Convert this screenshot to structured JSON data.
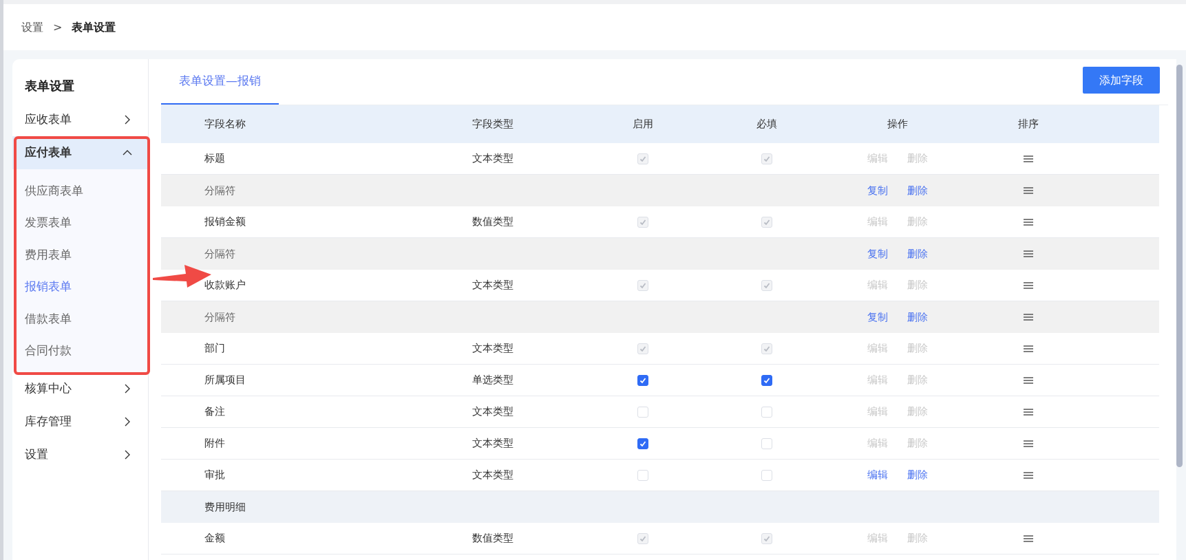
{
  "breadcrumb": [
    {
      "label": "设置",
      "current": false
    },
    {
      "label": "表单设置",
      "current": true
    }
  ],
  "breadcrumb_separator": ">",
  "sidebar": {
    "title": "表单设置",
    "items": [
      {
        "label": "应收表单",
        "expanded": false
      },
      {
        "label": "应付表单",
        "expanded": true,
        "children": [
          {
            "label": "供应商表单",
            "selected": false
          },
          {
            "label": "发票表单",
            "selected": false
          },
          {
            "label": "费用表单",
            "selected": false
          },
          {
            "label": "报销表单",
            "selected": true
          },
          {
            "label": "借款表单",
            "selected": false
          },
          {
            "label": "合同付款",
            "selected": false
          }
        ]
      },
      {
        "label": "核算中心",
        "expanded": false
      },
      {
        "label": "库存管理",
        "expanded": false
      },
      {
        "label": "设置",
        "expanded": false
      }
    ]
  },
  "tabs": [
    {
      "label": "表单设置—报销",
      "selected": true
    }
  ],
  "add_button": "添加字段",
  "table": {
    "columns": [
      "字段名称",
      "字段类型",
      "启用",
      "必填",
      "操作",
      "排序"
    ],
    "rows": [
      {
        "kind": "field",
        "name": "标题",
        "type": "文本类型",
        "enabled": {
          "checked": true,
          "disabled": true
        },
        "required": {
          "checked": true,
          "disabled": true
        },
        "actions": [
          {
            "label": "编辑",
            "disabled": true
          },
          {
            "label": "删除",
            "disabled": true
          }
        ]
      },
      {
        "kind": "separator",
        "name": "分隔符",
        "actions": [
          {
            "label": "复制",
            "disabled": false
          },
          {
            "label": "删除",
            "disabled": false
          }
        ]
      },
      {
        "kind": "field",
        "name": "报销金额",
        "type": "数值类型",
        "enabled": {
          "checked": true,
          "disabled": true
        },
        "required": {
          "checked": true,
          "disabled": true
        },
        "actions": [
          {
            "label": "编辑",
            "disabled": true
          },
          {
            "label": "删除",
            "disabled": true
          }
        ]
      },
      {
        "kind": "separator",
        "name": "分隔符",
        "actions": [
          {
            "label": "复制",
            "disabled": false
          },
          {
            "label": "删除",
            "disabled": false
          }
        ]
      },
      {
        "kind": "field",
        "name": "收款账户",
        "type": "文本类型",
        "enabled": {
          "checked": true,
          "disabled": true
        },
        "required": {
          "checked": true,
          "disabled": true
        },
        "actions": [
          {
            "label": "编辑",
            "disabled": true
          },
          {
            "label": "删除",
            "disabled": true
          }
        ]
      },
      {
        "kind": "separator",
        "name": "分隔符",
        "actions": [
          {
            "label": "复制",
            "disabled": false
          },
          {
            "label": "删除",
            "disabled": false
          }
        ]
      },
      {
        "kind": "field",
        "name": "部门",
        "type": "文本类型",
        "enabled": {
          "checked": true,
          "disabled": true
        },
        "required": {
          "checked": true,
          "disabled": true
        },
        "actions": [
          {
            "label": "编辑",
            "disabled": true
          },
          {
            "label": "删除",
            "disabled": true
          }
        ]
      },
      {
        "kind": "field",
        "name": "所属项目",
        "type": "单选类型",
        "enabled": {
          "checked": true,
          "disabled": false
        },
        "required": {
          "checked": true,
          "disabled": false
        },
        "actions": [
          {
            "label": "编辑",
            "disabled": true
          },
          {
            "label": "删除",
            "disabled": true
          }
        ]
      },
      {
        "kind": "field",
        "name": "备注",
        "type": "文本类型",
        "enabled": {
          "checked": false,
          "disabled": false
        },
        "required": {
          "checked": false,
          "disabled": false
        },
        "actions": [
          {
            "label": "编辑",
            "disabled": true
          },
          {
            "label": "删除",
            "disabled": true
          }
        ]
      },
      {
        "kind": "field",
        "name": "附件",
        "type": "文本类型",
        "enabled": {
          "checked": true,
          "disabled": false
        },
        "required": {
          "checked": false,
          "disabled": false
        },
        "actions": [
          {
            "label": "编辑",
            "disabled": true
          },
          {
            "label": "删除",
            "disabled": true
          }
        ]
      },
      {
        "kind": "field",
        "name": "审批",
        "type": "文本类型",
        "enabled": {
          "checked": false,
          "disabled": false
        },
        "required": {
          "checked": false,
          "disabled": false
        },
        "actions": [
          {
            "label": "编辑",
            "disabled": false
          },
          {
            "label": "删除",
            "disabled": false
          }
        ]
      },
      {
        "kind": "section",
        "name": "费用明细"
      },
      {
        "kind": "field",
        "name": "金额",
        "type": "数值类型",
        "enabled": {
          "checked": true,
          "disabled": true
        },
        "required": {
          "checked": true,
          "disabled": true
        },
        "actions": [
          {
            "label": "编辑",
            "disabled": true
          },
          {
            "label": "删除",
            "disabled": true
          }
        ]
      }
    ]
  }
}
